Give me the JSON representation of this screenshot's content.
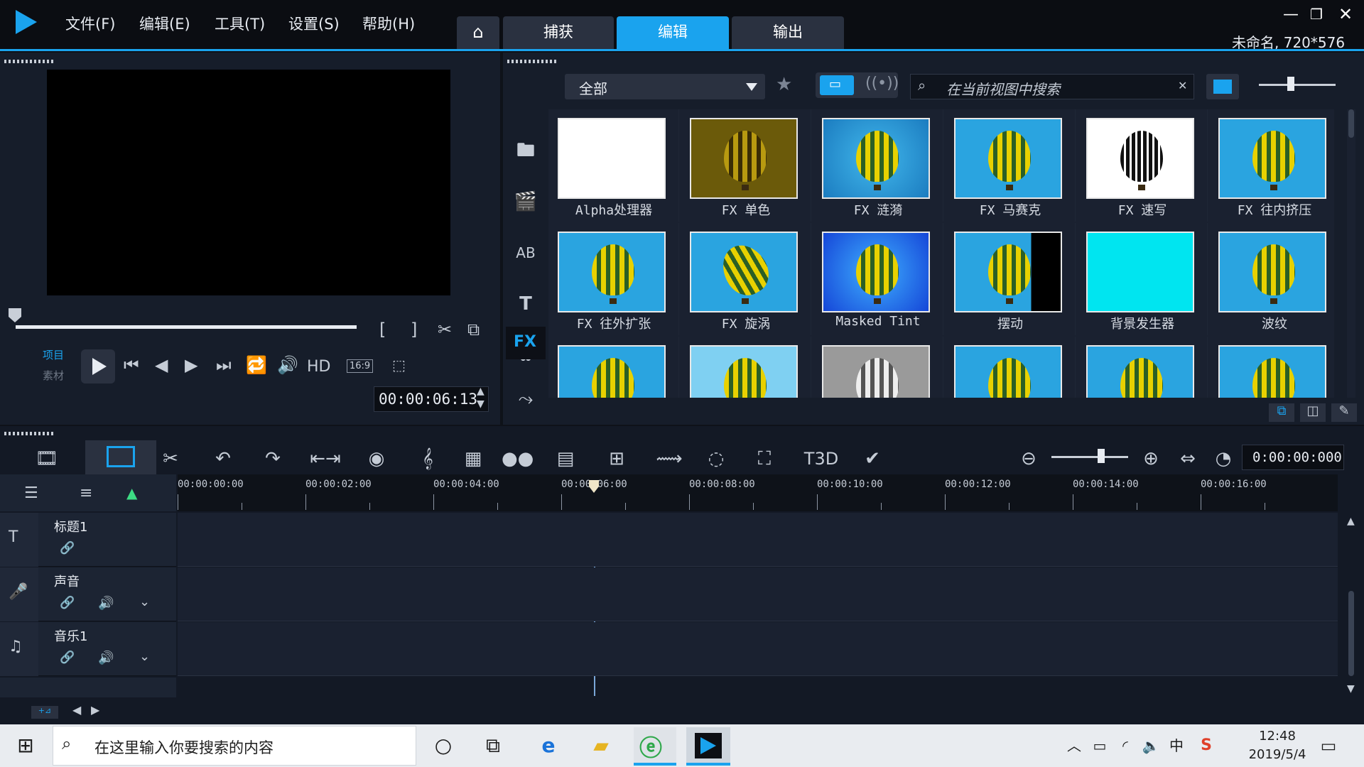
{
  "app": {
    "menu": [
      "文件(F)",
      "编辑(E)",
      "工具(T)",
      "设置(S)",
      "帮助(H)"
    ],
    "tabs": [
      "捕获",
      "编辑",
      "输出"
    ],
    "active_tab": "编辑",
    "project_info": "未命名, 720*576",
    "accent_color": "#1aa3ee"
  },
  "player": {
    "project_label": "项目",
    "clip_label": "素材",
    "hd_label": "HD",
    "aspect_label": "16:9",
    "timecode": "00:00:06:13"
  },
  "library": {
    "category": "全部",
    "search_placeholder": "在当前视图中搜索",
    "side_fx_label": "FX",
    "effects": [
      {
        "label": "Alpha处理器",
        "style": "white"
      },
      {
        "label": "FX 单色",
        "style": "mono"
      },
      {
        "label": "FX 涟漪",
        "style": "ripple"
      },
      {
        "label": "FX 马赛克",
        "style": "mosaic"
      },
      {
        "label": "FX 速写",
        "style": "sketch"
      },
      {
        "label": "FX 往内挤压",
        "style": "pinch"
      },
      {
        "label": "FX 往外扩张",
        "style": "bulge"
      },
      {
        "label": "FX 旋涡",
        "style": "twirl"
      },
      {
        "label": "Masked Tint",
        "style": "tint"
      },
      {
        "label": "摆动",
        "style": "swing"
      },
      {
        "label": "背景发生器",
        "style": "cyan"
      },
      {
        "label": "波纹",
        "style": "wave"
      },
      {
        "label": "",
        "style": "plain"
      },
      {
        "label": "",
        "style": "light"
      },
      {
        "label": "",
        "style": "gray"
      },
      {
        "label": "",
        "style": "plain"
      },
      {
        "label": "",
        "style": "plain"
      },
      {
        "label": "",
        "style": "plain"
      }
    ]
  },
  "timeline": {
    "timecode": "0:00:00:000",
    "ruler": [
      "00:00:00:00",
      "00:00:02:00",
      "00:00:04:00",
      "00:00:06:00",
      "00:00:08:00",
      "00:00:10:00",
      "00:00:12:00",
      "00:00:14:00",
      "00:00:16:00"
    ],
    "tracks": [
      {
        "name": "标题1",
        "icon": "title-icon"
      },
      {
        "name": "声音",
        "icon": "voice-icon"
      },
      {
        "name": "音乐1",
        "icon": "music-icon"
      }
    ]
  },
  "taskbar": {
    "search_placeholder": "在这里输入你要搜索的内容",
    "time": "12:48",
    "date": "2019/5/4",
    "ime": "中"
  }
}
